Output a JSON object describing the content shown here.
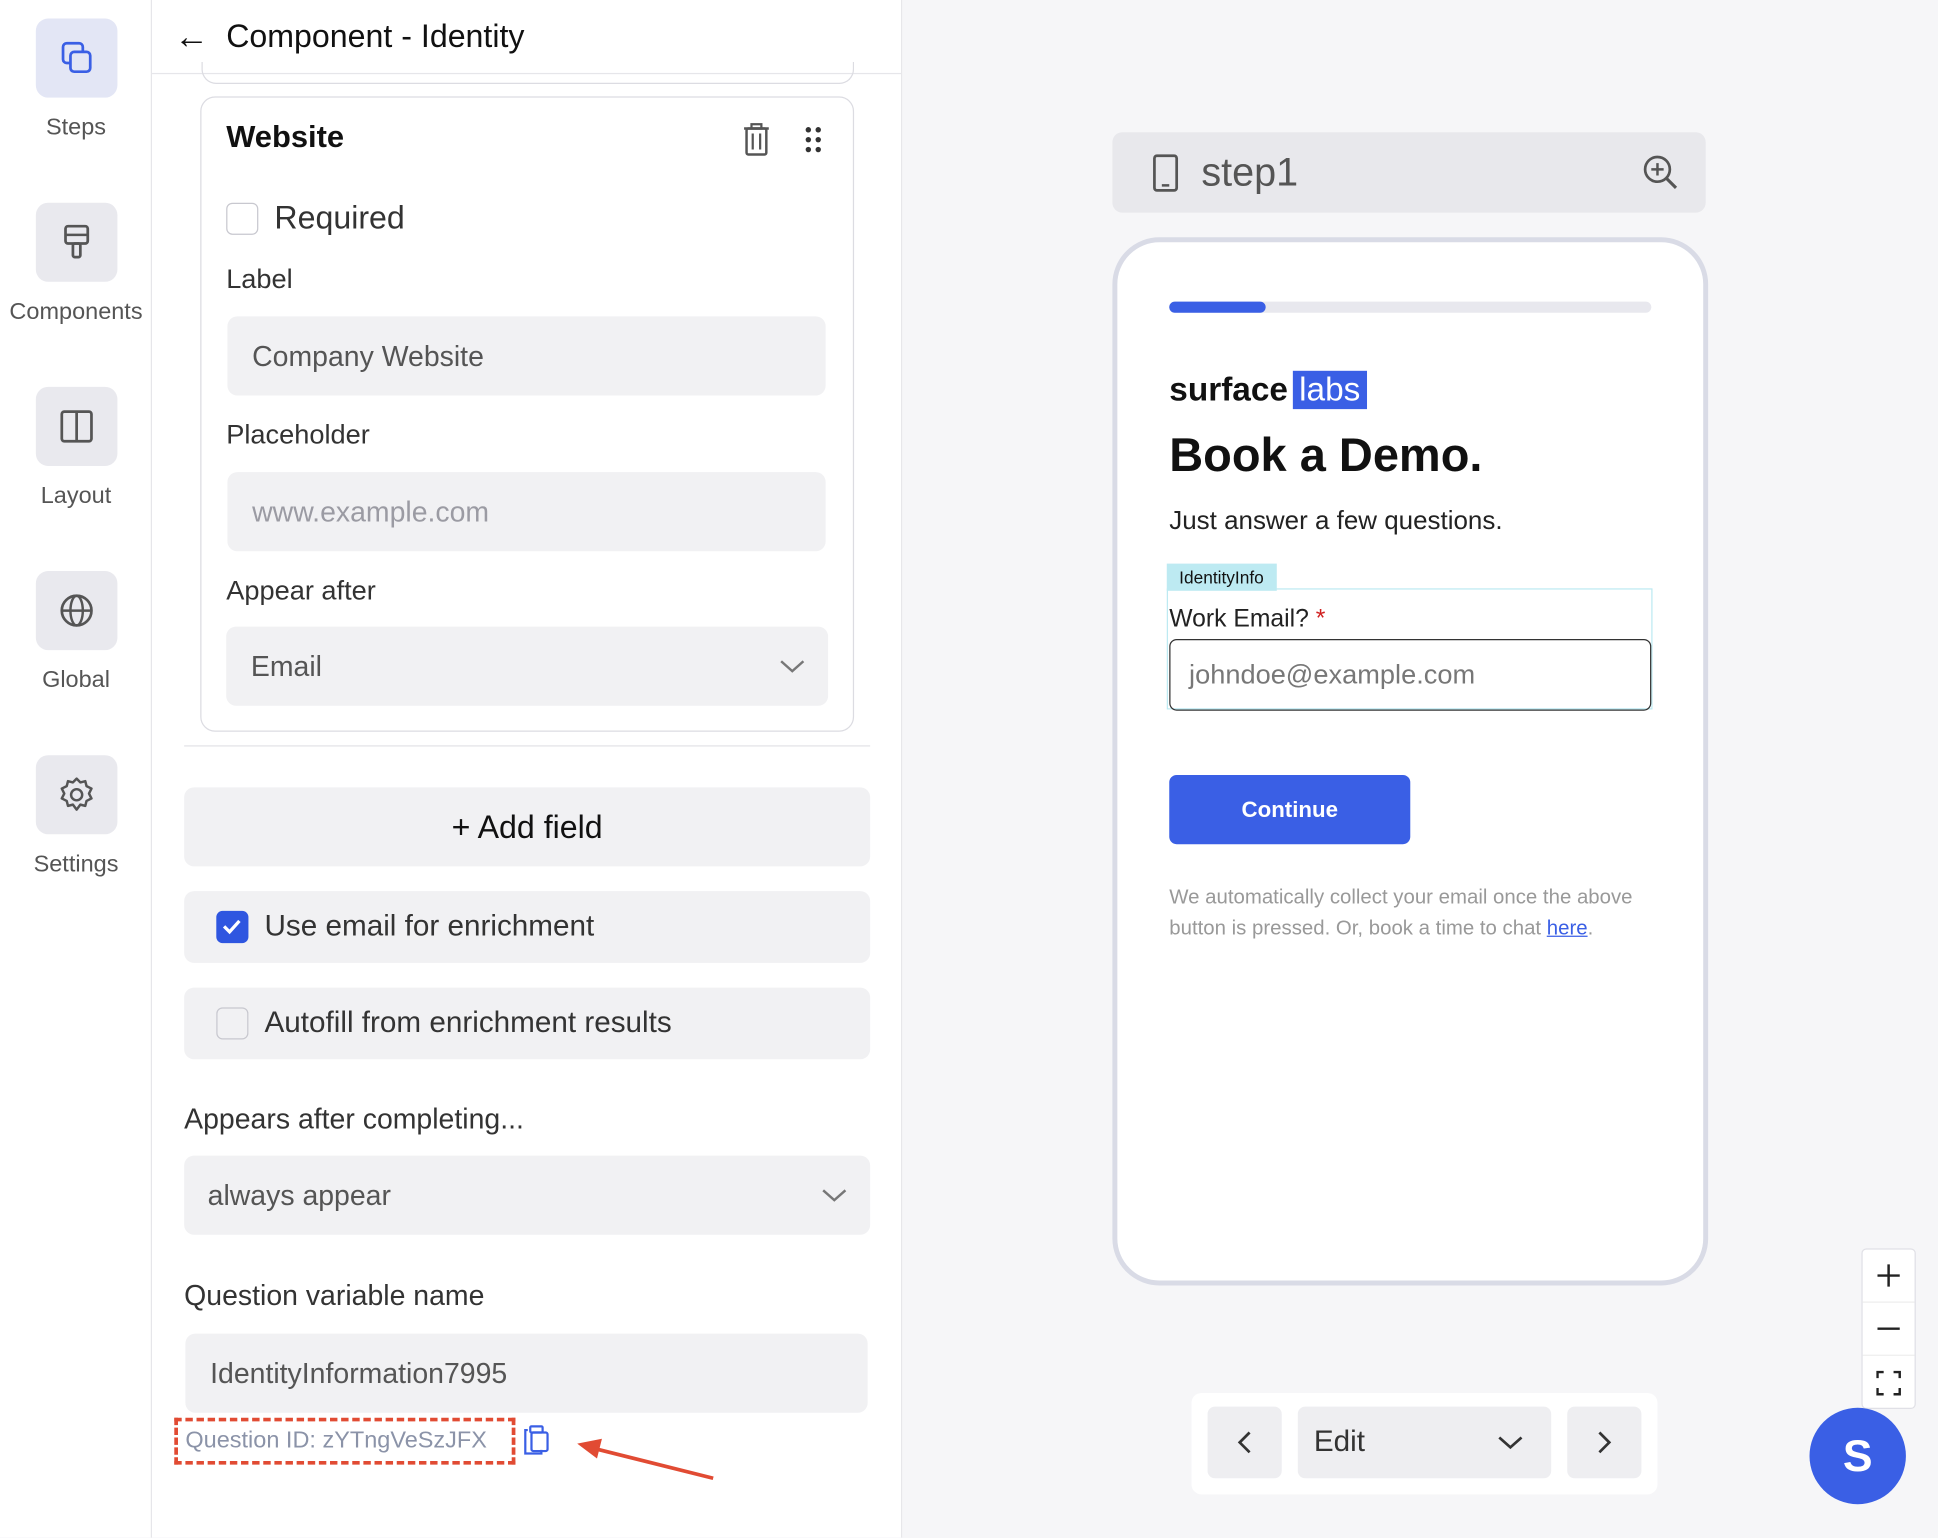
{
  "rail": {
    "items": [
      {
        "label": "Steps"
      },
      {
        "label": "Components"
      },
      {
        "label": "Layout"
      },
      {
        "label": "Global"
      },
      {
        "label": "Settings"
      }
    ]
  },
  "panel": {
    "title": "Component - Identity",
    "card": {
      "title": "Website",
      "required_label": "Required",
      "label_heading": "Label",
      "label_value": "Company Website",
      "placeholder_heading": "Placeholder",
      "placeholder_value": "www.example.com",
      "appear_after_heading": "Appear after",
      "appear_after_value": "Email"
    },
    "add_field": "+ Add field",
    "use_email_enrichment": "Use email for enrichment",
    "use_email_enrichment_checked": true,
    "autofill_enrichment": "Autofill from enrichment results",
    "autofill_enrichment_checked": false,
    "appears_after_heading": "Appears after completing...",
    "appears_after_value": "always appear",
    "variable_heading": "Question variable name",
    "variable_value": "IdentityInformation7995",
    "question_id": "Question ID: zYTngVeSzJFX"
  },
  "canvas": {
    "step_name": "step1",
    "progress": 0.2,
    "logo_text": "surface",
    "logo_badge": "labs",
    "title": "Book a Demo.",
    "subtitle": "Just answer a few questions.",
    "tag": "IdentityInfo",
    "email_label": "Work Email?",
    "email_required_mark": "*",
    "email_placeholder": "johndoe@example.com",
    "continue_label": "Continue",
    "disclaimer": "We automatically collect your email once the above button is pressed. Or, book a time to chat",
    "disclaimer_link": "here",
    "disclaimer_end": ".",
    "mode_select": "Edit",
    "fab_letter": "S",
    "accent_color": "#3a5fe5",
    "highlight_color": "#e14b33"
  }
}
